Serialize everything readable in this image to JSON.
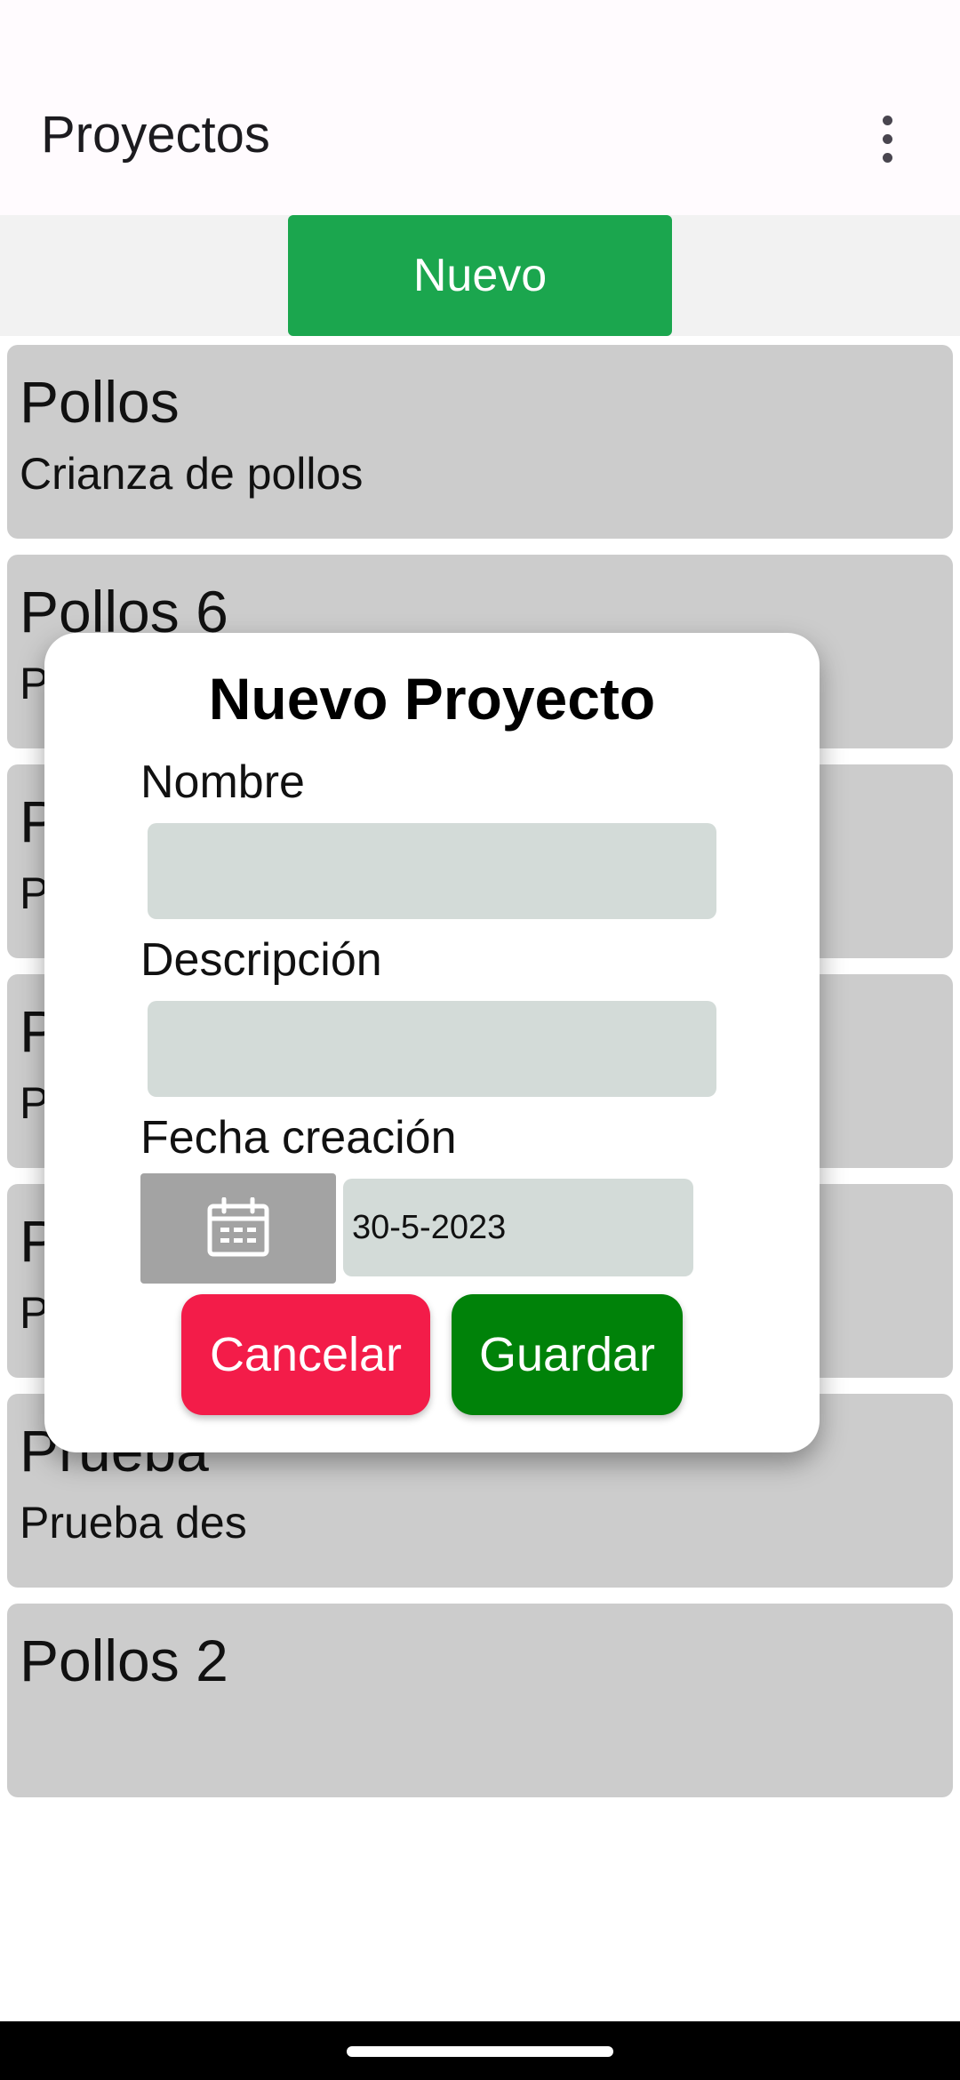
{
  "app_bar": {
    "title": "Proyectos",
    "menu_icon": "more-vert-icon"
  },
  "toolbar": {
    "new_label": "Nuevo",
    "new_color": "#1ba64e"
  },
  "projects": [
    {
      "name": "Pollos",
      "description": "Crianza de pollos"
    },
    {
      "name": "Pollos 6",
      "description": "P"
    },
    {
      "name": "P",
      "description": "P"
    },
    {
      "name": "P",
      "description": "P"
    },
    {
      "name": "P",
      "description": "P"
    },
    {
      "name": "Prueba",
      "description": "Prueba des"
    },
    {
      "name": "Pollos 2",
      "description": ""
    }
  ],
  "dialog": {
    "title": "Nuevo Proyecto",
    "name_label": "Nombre",
    "name_value": "",
    "description_label": "Descripción",
    "description_value": "",
    "date_label": "Fecha creación",
    "date_value": "30-5-2023",
    "calendar_icon": "calendar-icon",
    "cancel_label": "Cancelar",
    "cancel_color": "#f31c49",
    "save_label": "Guardar",
    "save_color": "#008209"
  }
}
